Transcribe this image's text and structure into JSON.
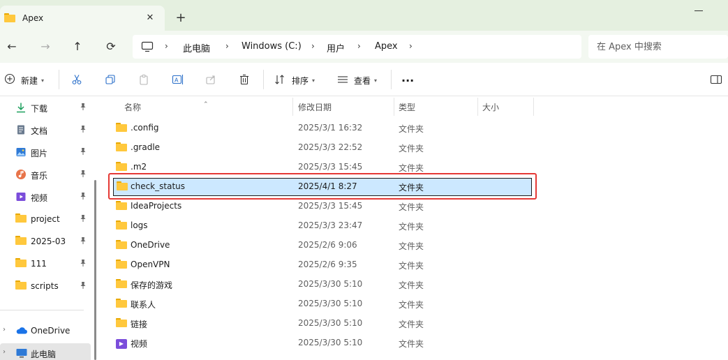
{
  "window": {
    "tab_title": "Apex",
    "tab_close": "✕",
    "new_tab": "+"
  },
  "nav": {
    "back": "←",
    "forward": "→",
    "up": "↑",
    "refresh": "⟳"
  },
  "address": {
    "separator": "›",
    "crumbs": [
      "此电脑",
      "Windows (C:)",
      "用户",
      "Apex"
    ]
  },
  "search": {
    "placeholder": "在 Apex 中搜索"
  },
  "toolbar": {
    "new_label": "新建",
    "sort_label": "排序",
    "view_label": "查看",
    "more": "···"
  },
  "sidebar": {
    "quick_access": [
      {
        "label": "下载",
        "icon": "download-icon"
      },
      {
        "label": "文档",
        "icon": "document-icon"
      },
      {
        "label": "图片",
        "icon": "picture-icon"
      },
      {
        "label": "音乐",
        "icon": "music-icon"
      },
      {
        "label": "视频",
        "icon": "video-icon"
      },
      {
        "label": "project",
        "icon": "folder-icon"
      },
      {
        "label": "2025-03",
        "icon": "folder-icon"
      },
      {
        "label": "111",
        "icon": "folder-icon"
      },
      {
        "label": "scripts",
        "icon": "folder-icon"
      }
    ],
    "onedrive": "OneDrive",
    "this_pc": "此电脑",
    "pin": "📌",
    "expander": "›"
  },
  "columns": {
    "name": "名称",
    "modified": "修改日期",
    "type": "类型",
    "size": "大小"
  },
  "files": [
    {
      "name": ".config",
      "modified": "2025/3/1 16:32",
      "type": "文件夹"
    },
    {
      "name": ".gradle",
      "modified": "2025/3/3 22:52",
      "type": "文件夹"
    },
    {
      "name": ".m2",
      "modified": "2025/3/3 15:45",
      "type": "文件夹"
    },
    {
      "name": "check_status",
      "modified": "2025/4/1 8:27",
      "type": "文件夹",
      "selected": true
    },
    {
      "name": "IdeaProjects",
      "modified": "2025/3/3 15:45",
      "type": "文件夹"
    },
    {
      "name": "logs",
      "modified": "2025/3/3 23:47",
      "type": "文件夹"
    },
    {
      "name": "OneDrive",
      "modified": "2025/2/6 9:06",
      "type": "文件夹"
    },
    {
      "name": "OpenVPN",
      "modified": "2025/2/6 9:35",
      "type": "文件夹"
    },
    {
      "name": "保存的游戏",
      "modified": "2025/3/30 5:10",
      "type": "文件夹"
    },
    {
      "name": "联系人",
      "modified": "2025/3/30 5:10",
      "type": "文件夹"
    },
    {
      "name": "链接",
      "modified": "2025/3/30 5:10",
      "type": "文件夹"
    },
    {
      "name": "视频",
      "modified": "2025/3/30 5:10",
      "type": "文件夹",
      "icon": "video-folder-icon"
    }
  ],
  "colors": {
    "accent_selected": "#cce8ff",
    "highlight": "#e53935",
    "tabbar": "#e5f0e0"
  }
}
